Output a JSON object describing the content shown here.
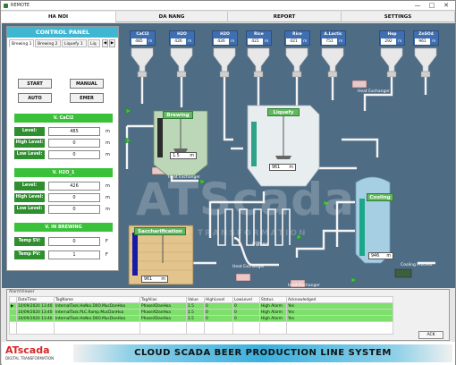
{
  "window": {
    "title": "REMOTE",
    "minimize": "—",
    "maximize": "□",
    "close": "✕"
  },
  "tabs": [
    {
      "label": "HA NOI",
      "active": true
    },
    {
      "label": "DA NANG",
      "active": false
    },
    {
      "label": "REPORT",
      "active": false
    },
    {
      "label": "SETTINGS",
      "active": false
    }
  ],
  "control_panel": {
    "title": "CONTROL PANEL",
    "subtabs": [
      "Brewing 1",
      "Brewing 2",
      "Liquefy 1",
      "Liq"
    ],
    "buttons": {
      "start": "START",
      "manual": "MANUAL",
      "auto": "AUTO",
      "emer": "EMER"
    },
    "groups": [
      {
        "header": "V. CaCl2",
        "fields": [
          {
            "label": "Level:",
            "value": "485",
            "unit": "m"
          },
          {
            "label": "High Level:",
            "value": "0",
            "unit": "m"
          },
          {
            "label": "Low Level:",
            "value": "0",
            "unit": "m"
          }
        ]
      },
      {
        "header": "V. H2O_1",
        "fields": [
          {
            "label": "Level:",
            "value": "426",
            "unit": "m"
          },
          {
            "label": "High Level:",
            "value": "0",
            "unit": "m"
          },
          {
            "label": "Low Level:",
            "value": "0",
            "unit": "m"
          }
        ]
      },
      {
        "header": "V. IN BREWING",
        "fields": [
          {
            "label": "Temp SV:",
            "value": "0",
            "unit": "F"
          },
          {
            "label": "Temp PV:",
            "value": "1",
            "unit": "F"
          }
        ]
      }
    ]
  },
  "sensors": [
    {
      "name": "CaCl2",
      "value": "485",
      "unit": "m"
    },
    {
      "name": "H2O",
      "value": "426",
      "unit": "m"
    },
    {
      "name": "H2O",
      "value": "426",
      "unit": "m"
    },
    {
      "name": "Rice",
      "value": "421",
      "unit": "m"
    },
    {
      "name": "Rice",
      "value": "421",
      "unit": "m"
    },
    {
      "name": "A.Lactic",
      "value": "751",
      "unit": "m"
    },
    {
      "name": "Hop",
      "value": "292",
      "unit": "m"
    },
    {
      "name": "ZnSO4",
      "value": "961",
      "unit": "m"
    }
  ],
  "vessels": {
    "brewing": {
      "label": "Brewing",
      "value": "1.5",
      "unit": "m"
    },
    "liquefy": {
      "label": "Liquefy",
      "value": "961",
      "unit": "m"
    },
    "cooling": {
      "label": "Cooling",
      "value": "946",
      "unit": "m"
    },
    "saccharification": {
      "label": "Saccharification",
      "value": "961",
      "unit": "m"
    },
    "filter": {
      "label": "Filter"
    }
  },
  "labels": {
    "heat_exchanger": "Heat Exchanger",
    "cooling_process": "Cooling Process",
    "watermark_main": "ATScada",
    "watermark_sub": "DIGITAL TRANSFORMATION"
  },
  "alarm_viewer": {
    "title": "AlarmViewer",
    "columns": [
      "",
      "DateTime",
      "TagName",
      "TagAlias",
      "Value",
      "HighLevel",
      "LowLevel",
      "Status",
      "Acknowledged"
    ],
    "rows": [
      [
        "▶",
        "10/09/2020 13:40",
        "InternalTask.HaNoi.D0O.MucDanHoa",
        "PhaseXDanHoa",
        "1.5",
        "0",
        "0",
        "High Alarm",
        "Yes"
      ],
      [
        "",
        "10/09/2020 13:40",
        "InternalTask.PLC.Ramp.MucDanHoa",
        "PhaseXDanHoa",
        "1.5",
        "0",
        "0",
        "High Alarm",
        "Yes"
      ],
      [
        "",
        "10/09/2020 13:40",
        "InternalTask.HaNoi.D0O.MucDanHoa",
        "PhaseXDanHoa",
        "1.5",
        "0",
        "0",
        "High Alarm",
        "Yes"
      ]
    ],
    "ack_button": "ACK"
  },
  "footer": {
    "logo_main": "ATscada",
    "logo_sub": "DIGITAL TRANSFORMATION",
    "banner": "CLOUD SCADA BEER PRODUCTION LINE SYSTEM"
  },
  "colors": {
    "background": "#4f6c85",
    "panel_header": "#3fb7d3",
    "green_bar": "#3ac13a",
    "sensor_box": "#3f6fb0",
    "alarm_row": "#7ce06a",
    "logo_red": "#d62828"
  }
}
